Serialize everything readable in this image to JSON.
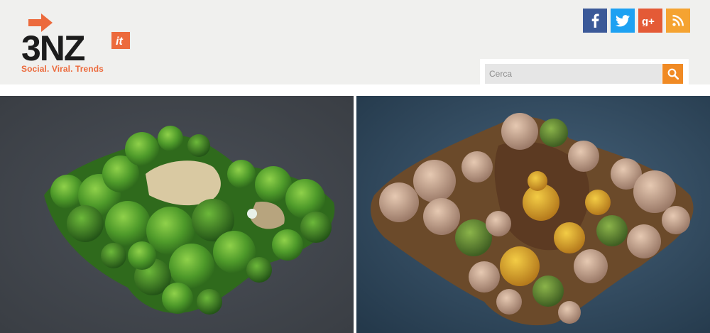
{
  "site": {
    "logo_text": "3NZ",
    "logo_badge": "it",
    "tagline": "Social. Viral. Trends"
  },
  "social": [
    {
      "name": "facebook",
      "icon": "facebook-icon",
      "color": "#3b5998"
    },
    {
      "name": "twitter",
      "icon": "twitter-icon",
      "color": "#1da1f2"
    },
    {
      "name": "google-plus",
      "icon": "google-plus-icon",
      "color": "#e45a36"
    },
    {
      "name": "rss",
      "icon": "rss-icon",
      "color": "#f5a331"
    }
  ],
  "search": {
    "placeholder": "Cerca",
    "button_icon": "search-icon",
    "button_color": "#f08a24"
  },
  "images": {
    "left": {
      "subject": "aerial view of green wooded island"
    },
    "right": {
      "subject": "aerial view of autumn wooded island"
    }
  },
  "colors": {
    "accent": "#ec6a3c",
    "header_bg": "#f0f0ee"
  }
}
